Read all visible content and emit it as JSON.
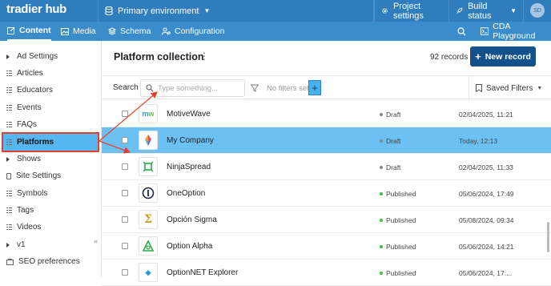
{
  "app": {
    "logo_text": "tradier hub",
    "environment": "Primary environment",
    "project_settings": "Project settings",
    "build_status": "Build status",
    "avatar_initials": "SD"
  },
  "nav": {
    "content": "Content",
    "media": "Media",
    "schema": "Schema",
    "configuration": "Configuration",
    "cda_playground": "CDA Playground"
  },
  "sidebar": {
    "items": [
      {
        "label": "Ad Settings",
        "icon": "caret-right-icon"
      },
      {
        "label": "Articles",
        "icon": "list-icon"
      },
      {
        "label": "Educators",
        "icon": "list-icon"
      },
      {
        "label": "Events",
        "icon": "list-icon"
      },
      {
        "label": "FAQs",
        "icon": "list-icon"
      },
      {
        "label": "Platforms",
        "icon": "list-icon"
      },
      {
        "label": "Shows",
        "icon": "caret-right-icon"
      },
      {
        "label": "Site Settings",
        "icon": "document-icon"
      },
      {
        "label": "Symbols",
        "icon": "list-icon"
      },
      {
        "label": "Tags",
        "icon": "list-icon"
      },
      {
        "label": "Videos",
        "icon": "list-icon"
      },
      {
        "label": "v1",
        "icon": "caret-right-icon"
      },
      {
        "label": "SEO preferences",
        "icon": "settings-icon"
      }
    ],
    "collapse_glyph": "«"
  },
  "collection": {
    "title": "Platform collection",
    "records": "92 records",
    "new_record": "New record"
  },
  "search": {
    "label": "Search",
    "placeholder": "Type something...",
    "filters": "No filters set",
    "saved_filters": "Saved Filters"
  },
  "rows": [
    {
      "name": "MotiveWave",
      "status": "Draft",
      "date": "02/04/2025, 11:21"
    },
    {
      "name": "My Company",
      "status": "Draft",
      "date": "Today, 12:13"
    },
    {
      "name": "NinjaSpread",
      "status": "Draft",
      "date": "02/04/2025, 11:33"
    },
    {
      "name": "OneOption",
      "status": "Published",
      "date": "05/06/2024, 17:49"
    },
    {
      "name": "Opción Sigma",
      "status": "Published",
      "date": "05/08/2024, 09:34"
    },
    {
      "name": "Option Alpha",
      "status": "Published",
      "date": "05/06/2024, 14:21"
    },
    {
      "name": "OptionNET Explorer",
      "status": "Published",
      "date": "05/06/2024, 17:..."
    }
  ],
  "colors": {
    "topbar": "#2f7dbd",
    "navbar": "#3a8ccb",
    "selected_row": "#6cc0f2",
    "draft": "#888888",
    "published": "#3cc23c",
    "annotation": "#e0412e"
  }
}
